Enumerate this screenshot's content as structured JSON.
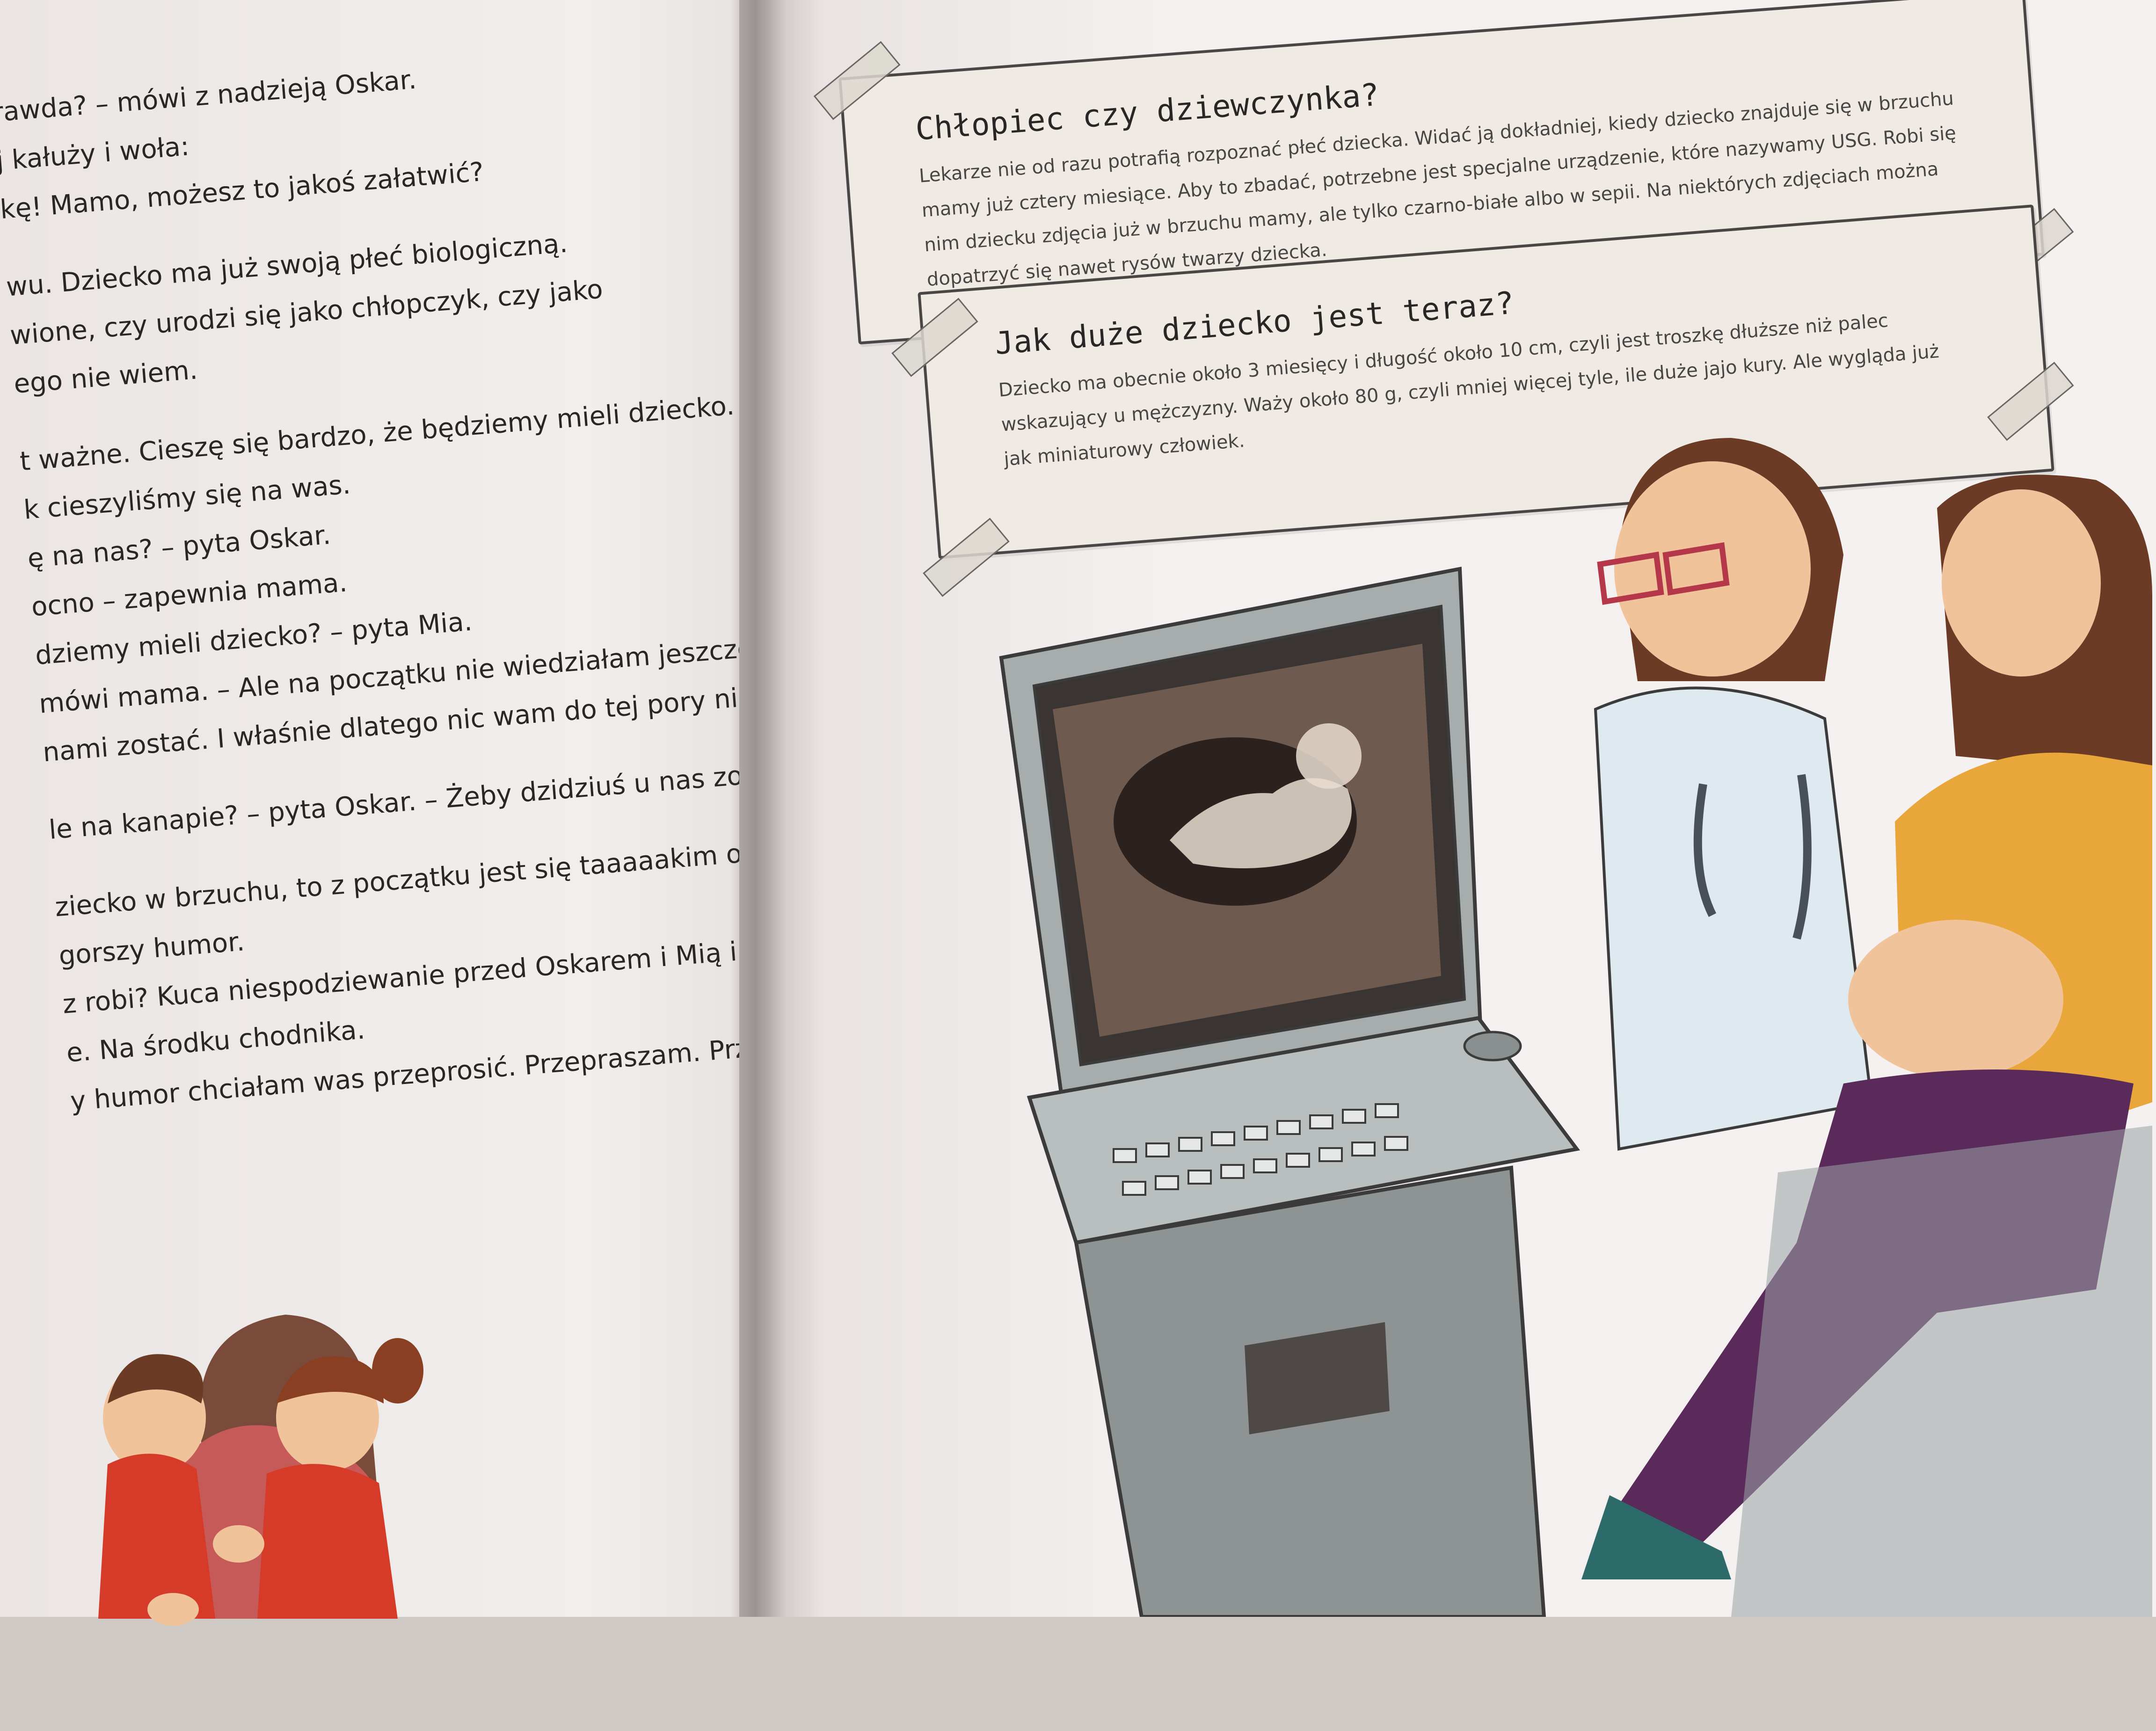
{
  "left_page": {
    "lines": [
      "rawda? – mówi z nadzieją Oskar.",
      "j kałuży i woła:",
      "kę! Mamo, możesz to jakoś załatwić?",
      "wu. Dziecko ma już swoją płeć biologiczną.",
      "wione, czy urodzi się jako chłopczyk, czy jako",
      "ego nie wiem.",
      "t ważne. Cieszę się bardzo, że będziemy mieli dziecko.",
      "k cieszyliśmy się na was.",
      "ę na nas? – pyta Oskar.",
      "ocno – zapewnia mama.",
      "dziemy mieli dziecko? – pyta Mia.",
      "mówi mama. – Ale na początku nie wiedziałam jeszcze,",
      " nami zostać. I właśnie dlatego nic wam do tej pory nie",
      "le na kanapie? – pyta Oskar. – Żeby dzidziuś u nas został?",
      "ziecko w brzuchu, to z początku jest się taaaaakim ospałym.",
      "gorszy humor.",
      "z robi? Kuca niespodziewanie przed Oskarem i Mią i bardzo",
      "e. Na środku chodnika.",
      "y humor chciałam was przeprosić. Przepraszam. Przepraszam –"
    ]
  },
  "info_box_1": {
    "title": "Chłopiec czy dziewczynka?",
    "body": "Lekarze nie od razu potrafią rozpoznać płeć dziecka. Widać ją dokładniej, kiedy dziecko znajduje się w brzuchu mamy już cztery miesiące. Aby to zbadać, potrzebne jest specjalne urządzenie, które nazywamy USG. Robi się nim dziecku zdjęcia już w brzuchu mamy, ale tylko czarno-białe albo w sepii. Na niektórych zdjęciach można dopatrzyć się nawet rysów twarzy dziecka."
  },
  "info_box_2": {
    "title": "Jak duże dziecko jest teraz?",
    "body": "Dziecko ma obecnie około 3 miesięcy i długość około 10 cm, czyli jest troszkę dłuższe niż palec wskazujący u mężczyzny. Waży około 80 g, czyli mniej więcej tyle, ile duże jajo kury. Ale wygląda już jak miniaturowy człowiek."
  },
  "colors": {
    "paper": "#f3f0ef",
    "ink": "#2a2626",
    "box_fill": "#efeae4",
    "machine_gray": "#9ea3a3",
    "screen_sepia": "#6e5a4e",
    "sweater_yellow": "#e9a63a",
    "pants_purple": "#5a2a5a",
    "hair_brown": "#6b3b25"
  }
}
